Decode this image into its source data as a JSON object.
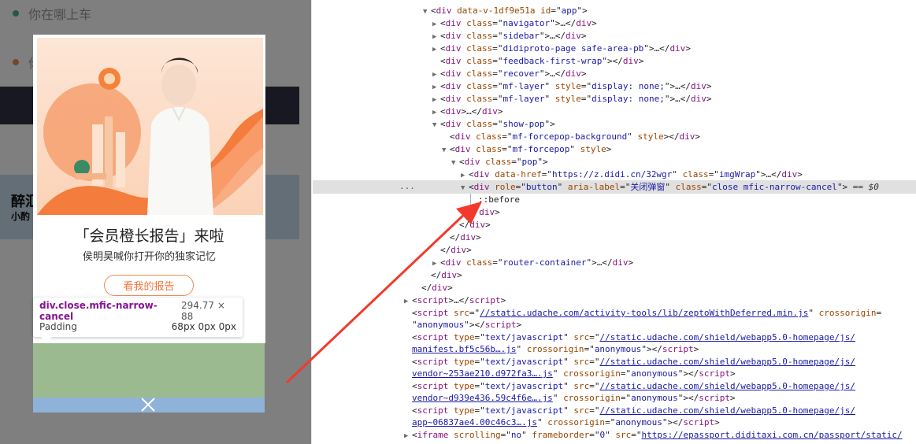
{
  "mobile": {
    "bg_row1": "你在哪上车",
    "bg_row2": "你",
    "bg_big": "醉汇",
    "bg_small": "小酌",
    "dot1_color": "#4cb08a",
    "dot2_color": "#f08a50",
    "popup": {
      "title": "「会员橙长报告」来啦",
      "subtitle": "侯明昊喊你打开你的独家记忆",
      "cta": "看我的报告"
    },
    "tooltip": {
      "name": "div.close.mfic-narrow-cancel",
      "size": "294.77 × 88",
      "label": "Padding",
      "value": "68px 0px 0px"
    }
  },
  "devtools": {
    "ellipsis": "...",
    "lines": [
      {
        "i": 0,
        "d": 3,
        "tri": "",
        "segs": [
          [
            "t",
            "<div "
          ],
          [
            "a",
            "data-v-1df9e51a"
          ],
          [
            "t",
            " "
          ],
          [
            "a",
            "id"
          ],
          [
            "e",
            "=\""
          ],
          [
            "v",
            "app"
          ],
          [
            "e",
            "\""
          ],
          [
            "t",
            ">"
          ]
        ]
      }
    ],
    "selected_tail": "== $0"
  }
}
